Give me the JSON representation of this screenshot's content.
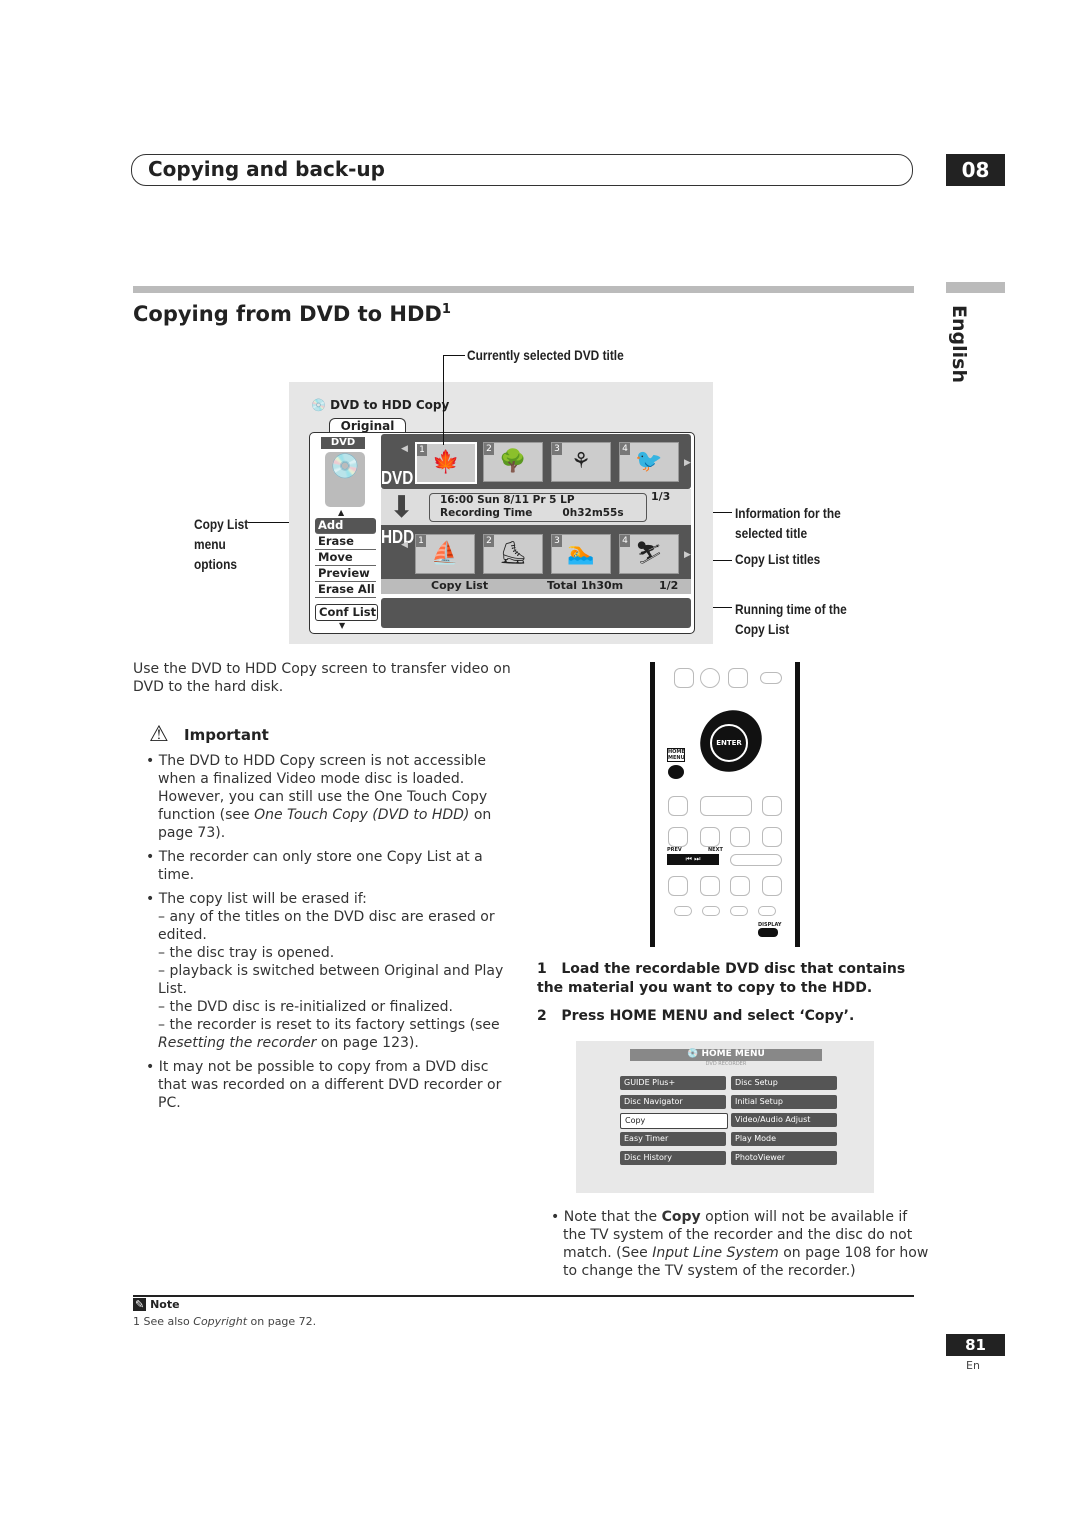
{
  "header": {
    "section_title": "Copying and back-up",
    "chapter": "08",
    "language": "English"
  },
  "heading": {
    "title": "Copying from DVD to HDD",
    "footnote_ref": "1"
  },
  "figure": {
    "callouts": {
      "current_title": "Currently selected DVD title",
      "copy_list_menu": "Copy List menu options",
      "info": "Information for the selected title",
      "copy_list_titles": "Copy List titles",
      "running_time": "Running time of the Copy List"
    },
    "screen": {
      "title": "DVD to HDD Copy",
      "tab": "Original",
      "dvd_badge": "DVD",
      "dvd_label": "DVD",
      "hdd_label": "HDD",
      "dvd_thumbs": [
        "1",
        "2",
        "3",
        "4"
      ],
      "hdd_thumbs": [
        "1",
        "2",
        "3",
        "4"
      ],
      "info_line1": "16:00 Sun  8/11    Pr 5  LP",
      "info_line2_label": "Recording Time",
      "info_line2_value": "0h32m55s",
      "dvd_page": "1/3",
      "copy_list_label": "Copy List",
      "total": "Total  1h30m",
      "hdd_page": "1/2",
      "menu": [
        "Add",
        "Erase",
        "Move",
        "Preview",
        "Erase All"
      ],
      "conf_list": "Conf List"
    }
  },
  "intro": "Use the DVD to HDD Copy screen to transfer video on DVD to the hard disk.",
  "important": {
    "title": "Important",
    "b1": "The DVD to HDD Copy screen is not accessible when a finalized Video mode disc is loaded. However, you can still use the One Touch Copy function (see ",
    "b1_ref": "One Touch Copy (DVD to HDD)",
    "b1_end": " on page 73).",
    "b2": "The recorder can only store one Copy List at a time.",
    "b3": "The copy list will be erased if:",
    "sub1": "– any of the titles on the DVD disc are erased or edited.",
    "sub2": "– the disc tray is opened.",
    "sub3": "– playback is switched between Original and Play List.",
    "sub4": "– the DVD disc is re-initialized or finalized.",
    "sub5": "– the recorder is reset to its factory settings (see ",
    "sub5_ref": "Resetting the recorder",
    "sub5_end": " on page 123).",
    "b4": "It may not be possible to copy from a DVD disc that was recorded on a different DVD recorder or PC."
  },
  "remote": {
    "home_menu": "HOME MENU",
    "enter": "ENTER",
    "prev": "PREV",
    "next": "NEXT",
    "display": "DISPLAY"
  },
  "steps": [
    {
      "n": "1",
      "text": "Load the recordable DVD disc that contains the material you want to copy to the HDD."
    },
    {
      "n": "2",
      "text": "Press HOME MENU and select ‘Copy’."
    }
  ],
  "home_menu": {
    "title": "HOME MENU",
    "subtitle": "DVD RECORDER",
    "left": [
      "GUIDE Plus+",
      "Disc Navigator",
      "Copy",
      "Easy Timer",
      "Disc History"
    ],
    "right": [
      "Disc Setup",
      "Initial Setup",
      "Video/Audio Adjust",
      "Play Mode",
      "PhotoViewer"
    ],
    "selected": "Copy"
  },
  "note_bullet": {
    "a": "Note that the ",
    "bold": "Copy",
    "b": " option will not be available if the TV system of the recorder and the disc do not match. (See ",
    "ref": "Input Line System",
    "c": " on page 108 for how to change the TV system of the recorder.)"
  },
  "note": {
    "label": "Note",
    "text": "1 See also ",
    "ref": "Copyright",
    "end": " on page 72."
  },
  "footer": {
    "page": "81",
    "lang": "En"
  }
}
